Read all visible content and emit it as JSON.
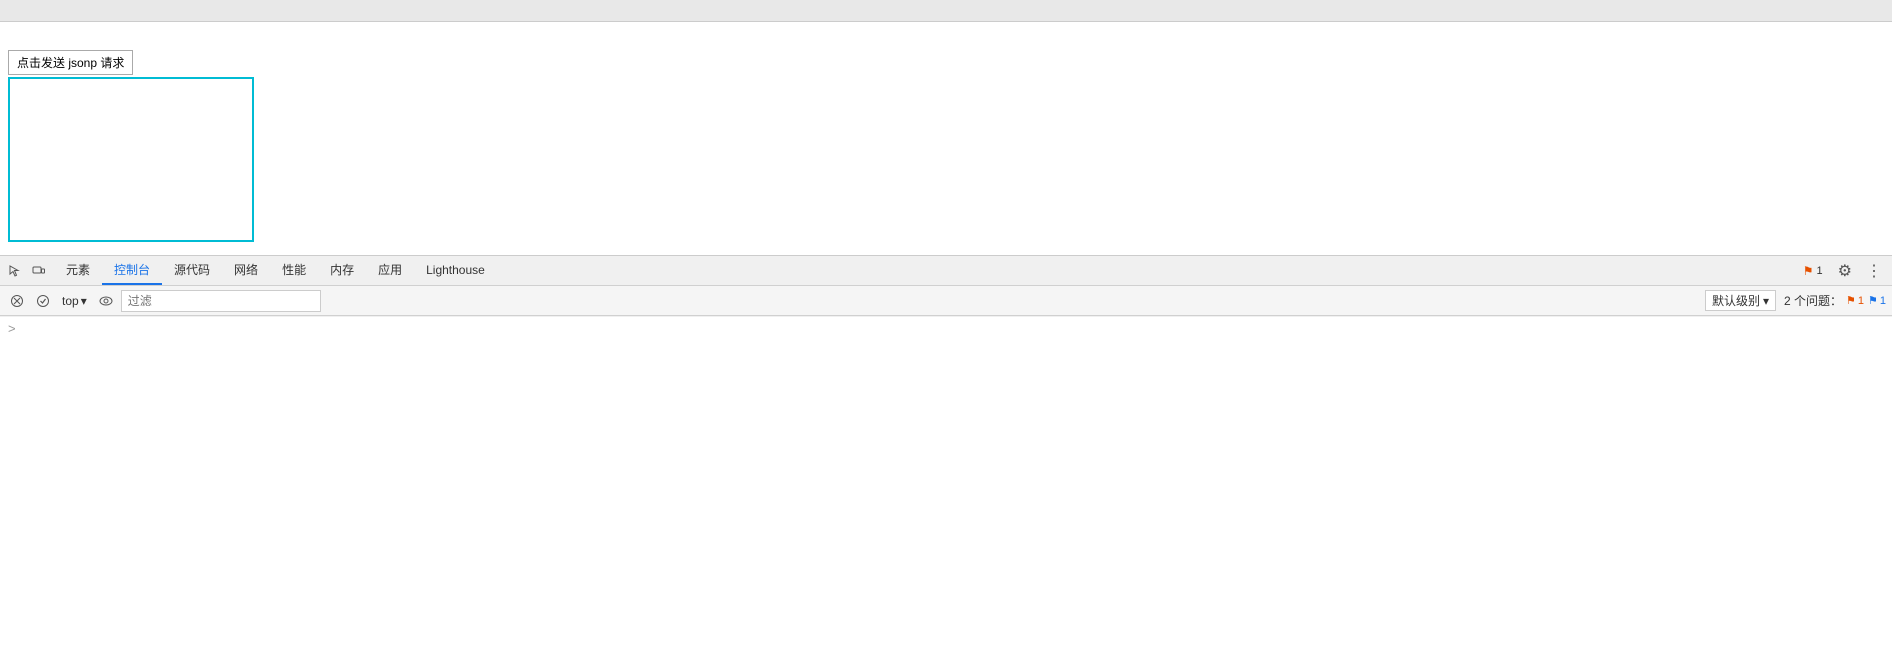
{
  "browser": {
    "top_bar_height": 22
  },
  "webpage": {
    "button_label": "点击发送 jsonp 请求"
  },
  "devtools": {
    "tabs": [
      {
        "id": "elements",
        "label": "元素",
        "active": false
      },
      {
        "id": "console",
        "label": "控制台",
        "active": true
      },
      {
        "id": "sources",
        "label": "源代码",
        "active": false
      },
      {
        "id": "network",
        "label": "网络",
        "active": false
      },
      {
        "id": "performance",
        "label": "性能",
        "active": false
      },
      {
        "id": "memory",
        "label": "内存",
        "active": false
      },
      {
        "id": "application",
        "label": "应用",
        "active": false
      },
      {
        "id": "lighthouse",
        "label": "Lighthouse",
        "active": false
      }
    ],
    "flag_badge_count": "1",
    "console_toolbar": {
      "context_label": "top",
      "filter_placeholder": "过滤",
      "default_level_label": "默认级别",
      "issues_label": "2 个问题：",
      "issues_orange_flag": "1",
      "issues_blue_flag": "1"
    },
    "console_prompt": ">"
  }
}
